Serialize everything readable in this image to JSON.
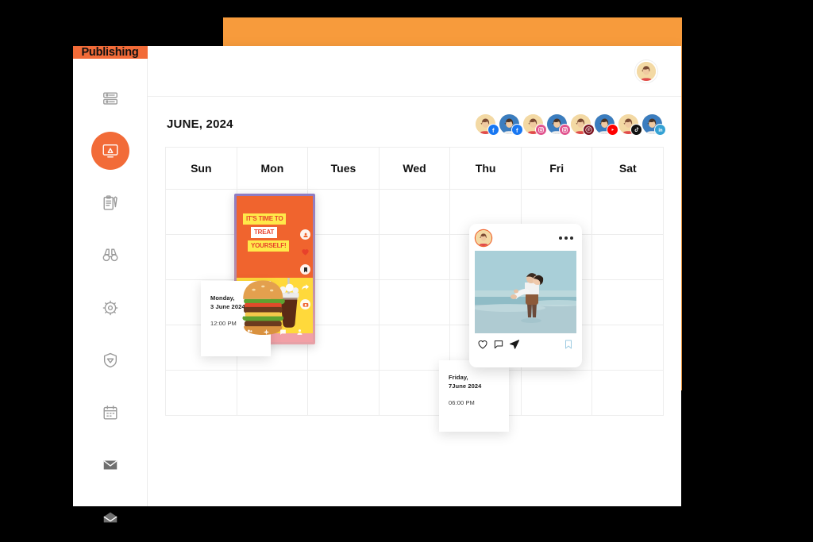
{
  "window": {
    "brand_label": "Publishing"
  },
  "sidebar": {
    "items": [
      {
        "icon": "sliders-icon",
        "name": "sidebar-item-dashboard",
        "active": false
      },
      {
        "icon": "monitor-icon",
        "name": "sidebar-item-publishing",
        "active": true
      },
      {
        "icon": "clipboard-icon",
        "name": "sidebar-item-tasks",
        "active": false
      },
      {
        "icon": "binoculars-icon",
        "name": "sidebar-item-monitoring",
        "active": false
      },
      {
        "icon": "gear-icon",
        "name": "sidebar-item-settings",
        "active": false
      },
      {
        "icon": "shield-icon",
        "name": "sidebar-item-security",
        "active": false
      },
      {
        "icon": "calendar-icon",
        "name": "sidebar-item-calendar",
        "active": false
      },
      {
        "icon": "envelope-icon",
        "name": "sidebar-item-mail",
        "active": false
      },
      {
        "icon": "open-mail-icon",
        "name": "sidebar-item-inbox",
        "active": false
      }
    ]
  },
  "topbar": {
    "avatar_icon": "user-avatar"
  },
  "calendar": {
    "month_title": "JUNE, 2024",
    "weekdays": [
      "Sun",
      "Mon",
      "Tues",
      "Wed",
      "Thu",
      "Fri",
      "Sat"
    ],
    "body_rows": 5
  },
  "channels": [
    {
      "platform": "facebook",
      "color": "#1877F2",
      "avatar_bg": "#F3D9A4"
    },
    {
      "platform": "facebook",
      "color": "#1877F2",
      "avatar_bg": "#3B7DBF"
    },
    {
      "platform": "instagram",
      "color": "#E1558F",
      "avatar_bg": "#F3D9A4"
    },
    {
      "platform": "instagram",
      "color": "#E1558F",
      "avatar_bg": "#3B7DBF"
    },
    {
      "platform": "pinterest",
      "color": "#7A1320",
      "avatar_bg": "#F3D9A4"
    },
    {
      "platform": "youtube",
      "color": "#FF0000",
      "avatar_bg": "#3B7DBF"
    },
    {
      "platform": "tiktok",
      "color": "#111111",
      "avatar_bg": "#F3D9A4"
    },
    {
      "platform": "linkedin",
      "color": "#35A2D4",
      "avatar_bg": "#3B7DBF"
    }
  ],
  "posts": {
    "story": {
      "headline_line1": "IT'S TIME TO",
      "headline_line2": "TREAT",
      "headline_line3": "YOURSELF!",
      "meta": {
        "day": "Monday,",
        "date": "3 June 2024",
        "time": "12:00 PM"
      }
    },
    "instagram": {
      "meta": {
        "day": "Friday,",
        "date": "7June 2024",
        "time": "06:00 PM"
      }
    }
  },
  "colors": {
    "brand_orange": "#F26B38",
    "accent_orange": "#F79B3C",
    "grid_line": "#ededed",
    "page_background": "#000000"
  }
}
